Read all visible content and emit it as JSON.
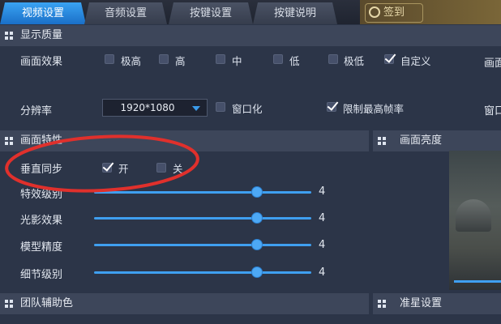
{
  "tabs": [
    {
      "label": "视频设置",
      "active": true
    },
    {
      "label": "音频设置",
      "active": false
    },
    {
      "label": "按键设置",
      "active": false
    },
    {
      "label": "按键说明",
      "active": false
    }
  ],
  "checkin": {
    "label": "签到"
  },
  "sections": {
    "display_quality": {
      "title": "显示质量"
    },
    "picture_features": {
      "title": "画面特性"
    },
    "brightness": {
      "title": "画面亮度"
    },
    "team_color": {
      "title": "团队辅助色"
    },
    "crosshair": {
      "title": "准星设置"
    }
  },
  "picture_effect": {
    "label": "画面效果",
    "options": [
      {
        "label": "极高",
        "checked": false
      },
      {
        "label": "高",
        "checked": false
      },
      {
        "label": "中",
        "checked": false
      },
      {
        "label": "低",
        "checked": false
      },
      {
        "label": "极低",
        "checked": false
      },
      {
        "label": "自定义",
        "checked": true
      }
    ],
    "right_cut_label": "画面"
  },
  "resolution": {
    "label": "分辨率",
    "value": "1920*1080",
    "windowed": {
      "label": "窗口化",
      "checked": false
    },
    "limit_fps": {
      "label": "限制最高帧率",
      "checked": true
    },
    "right_cut_label": "窗口"
  },
  "vsync": {
    "label": "垂直同步",
    "on": {
      "label": "开",
      "checked": true
    },
    "off": {
      "label": "关",
      "checked": false
    }
  },
  "sliders": [
    {
      "label": "特效级别",
      "value": 4,
      "fraction": 0.75
    },
    {
      "label": "光影效果",
      "value": 4,
      "fraction": 0.75
    },
    {
      "label": "模型精度",
      "value": 4,
      "fraction": 0.75
    },
    {
      "label": "细节级别",
      "value": 4,
      "fraction": 0.75
    }
  ],
  "colors": {
    "accent": "#3a9bea",
    "annotation": "#e0302c"
  }
}
